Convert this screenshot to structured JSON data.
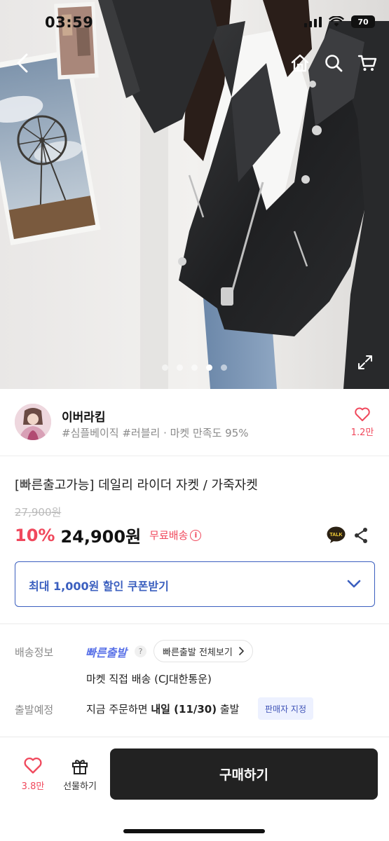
{
  "status_bar": {
    "time": "03:59",
    "battery": "70"
  },
  "hero": {
    "image_count": 5,
    "active_index": 3
  },
  "seller": {
    "name": "이버라킴",
    "tags": "#심플베이직 #러블리 · 마켓 만족도 95%",
    "wish_count": "1.2만"
  },
  "product": {
    "title": "[빠른출고가능] 데일리 라이더 자켓 / 가죽자켓",
    "original_price": "27,900원",
    "discount": "10%",
    "price": "24,900원",
    "free_shipping": "무료배송",
    "talk_label": "TALK"
  },
  "coupon": {
    "label": "최대 1,000원 할인 쿠폰받기"
  },
  "shipping": {
    "info_label": "배송정보",
    "fast_tag": "빠른출발",
    "fast_all_label": "빠른출발 전체보기",
    "method": "마켓 직접 배송 (CJ대한통운)",
    "departure_label": "출발예정",
    "departure_prefix": "지금 주문하면 ",
    "departure_bold": "내일 (11/30)",
    "departure_suffix": " 출발",
    "seller_set_badge": "판매자 지정"
  },
  "bottom_bar": {
    "wish_count": "3.8만",
    "gift_label": "선물하기",
    "buy_label": "구매하기"
  },
  "colors": {
    "accent_pink": "#f0485c",
    "coupon_blue": "#3b5fbf",
    "fast_blue": "#5b73e8",
    "button_dark": "#222222"
  }
}
